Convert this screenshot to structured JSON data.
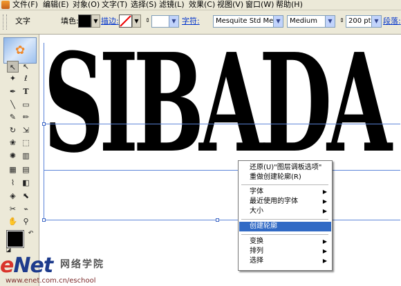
{
  "menubar": {
    "items": [
      "文件(F)",
      "编辑(E)",
      "对象(O)",
      "文字(T)",
      "选择(S)",
      "滤镜(L)",
      "效果(C)",
      "视图(V)",
      "窗口(W)",
      "帮助(H)"
    ]
  },
  "control_bar": {
    "tool_label": "文字",
    "fill_label": "填色:",
    "stroke_label": "描边:",
    "char_label": "字符:",
    "font_family": "Mesquite Std Medium",
    "font_style": "Medium",
    "font_size": "200 pt",
    "paragraph_label": "段落:",
    "fill_color": "#000000",
    "stroke_value": "none"
  },
  "canvas": {
    "text": "SIBADA"
  },
  "context_menu": {
    "items": [
      {
        "label": "还原(U)\"图层调板选项\"",
        "has_submenu": false
      },
      {
        "label": "重做创建轮廓(R)",
        "has_submenu": false
      },
      {
        "label": "字体",
        "has_submenu": true
      },
      {
        "label": "最近使用的字体",
        "has_submenu": true
      },
      {
        "label": "大小",
        "has_submenu": true
      },
      {
        "label": "创建轮廓",
        "has_submenu": false,
        "highlighted": true
      },
      {
        "label": "变换",
        "has_submenu": true
      },
      {
        "label": "排列",
        "has_submenu": true
      },
      {
        "label": "选择",
        "has_submenu": true
      }
    ]
  },
  "watermark": {
    "logo_e": "e",
    "logo_rest": "Net",
    "chinese": "网络学院",
    "url": "www.enet.com.cn/eschool"
  }
}
